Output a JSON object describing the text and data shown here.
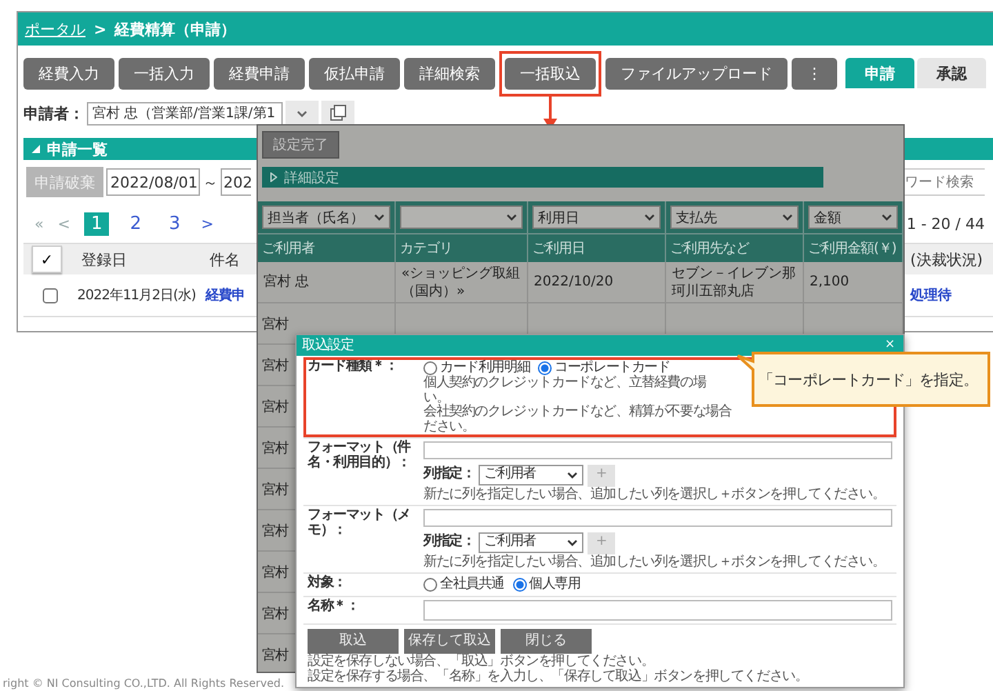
{
  "breadcrumb": {
    "link": "ポータル",
    "separator": ">",
    "current": "経費精算（申請）"
  },
  "toolbar": {
    "buttons": [
      {
        "label": "経費入力",
        "highlighted": false
      },
      {
        "label": "一括入力",
        "highlighted": false
      },
      {
        "label": "経費申請",
        "highlighted": false
      },
      {
        "label": "仮払申請",
        "highlighted": false
      },
      {
        "label": "詳細検索",
        "highlighted": false
      },
      {
        "label": "一括取込",
        "highlighted": true
      },
      {
        "label": "ファイルアップロード",
        "highlighted": false
      },
      {
        "label": "⋮",
        "highlighted": false
      }
    ],
    "tabs": [
      {
        "label": "申請",
        "selected": true
      },
      {
        "label": "承認",
        "selected": false
      }
    ]
  },
  "applicant": {
    "label": "申請者：",
    "value": "宮村 忠（営業部/営業1課/第1"
  },
  "list": {
    "title": "申請一覧",
    "discard_button": {
      "label": "申請破棄",
      "disabled": true
    },
    "date_from": "2022/08/01",
    "range_separator": "～",
    "date_to": "202",
    "keyword_placeholder": "ワード検索",
    "pagination": {
      "first": "«",
      "prev": "<",
      "pages": [
        {
          "label": "1",
          "selected": true
        },
        {
          "label": "2",
          "selected": false
        },
        {
          "label": "3",
          "selected": false
        }
      ],
      "next": ">",
      "summary": "1 - 20 / 44"
    },
    "table": {
      "select_all": "✓",
      "columns": [
        "登録日",
        "件名",
        "(決裁状況)"
      ],
      "rows": [
        {
          "checked": false,
          "date": "2022年11月2日(水)",
          "subject": "経費申",
          "status": "処理待"
        }
      ]
    }
  },
  "import_window": {
    "done_button": "設定完了",
    "detail_bar": "詳細設定",
    "column_selects": [
      {
        "value": "担当者（氏名）"
      },
      {
        "blank": true
      },
      {
        "value": "利用日"
      },
      {
        "value": "支払先"
      },
      {
        "value": "金額"
      }
    ],
    "columns": [
      "ご利用者",
      "カテゴリ",
      "ご利用日",
      "ご利用先など",
      "ご利用金額(￥)"
    ],
    "rows": [
      {
        "cells": [
          "宮村 忠",
          "«ショッピング取組（国内）»",
          "2022/10/20",
          "セブン－イレブン那珂川五部丸店",
          "2,100"
        ]
      }
    ],
    "more_rows": [
      {
        "user": "宮村"
      },
      {
        "user": "宮村"
      },
      {
        "user": "宮村"
      },
      {
        "user": "宮村"
      },
      {
        "user": "宮村"
      },
      {
        "user": "宮村"
      },
      {
        "user": "宮村"
      },
      {
        "user": "宮村"
      },
      {
        "user": "宮村"
      }
    ]
  },
  "dialog": {
    "title": "取込設定",
    "close": "×",
    "card_type": {
      "label": "カード種類＊：",
      "highlighted": true,
      "options": [
        {
          "label": "カード利用明細",
          "selected": false
        },
        {
          "label": "コーポレートカード",
          "selected": true
        }
      ],
      "notes": [
        "個人契約のクレジットカードなど、立替経費の場",
        "い。",
        "会社契約のクレジットカードなど、精算が不要な場合",
        "ださい。"
      ]
    },
    "formats": [
      {
        "label": "フォーマット（件名・利用目的）：",
        "column_label": "列指定：",
        "column_value": "ご利用者",
        "add": "+",
        "hint": "新たに列を指定したい場合、追加したい列を選択し＋ボタンを押してください。"
      },
      {
        "label": "フォーマット（メモ）：",
        "column_label": "列指定：",
        "column_value": "ご利用者",
        "add": "+",
        "hint": "新たに列を指定したい場合、追加したい列を選択し＋ボタンを押してください。"
      }
    ],
    "target": {
      "label": "対象：",
      "options": [
        {
          "label": "全社員共通",
          "selected": false
        },
        {
          "label": "個人専用",
          "selected": true
        }
      ]
    },
    "name": {
      "label": "名称＊："
    },
    "buttons": [
      "取込",
      "保存して取込",
      "閉じる"
    ],
    "notes": [
      "設定を保存しない場合、「取込」ボタンを押してください。",
      "設定を保存する場合、「名称」を入力し、「保存して取込」ボタンを押してください。"
    ]
  },
  "callout": {
    "text": "「コーポレートカード」を指定。"
  },
  "footer": {
    "copyright": "right © NI Consulting CO.,LTD. All Rights Reserved."
  }
}
